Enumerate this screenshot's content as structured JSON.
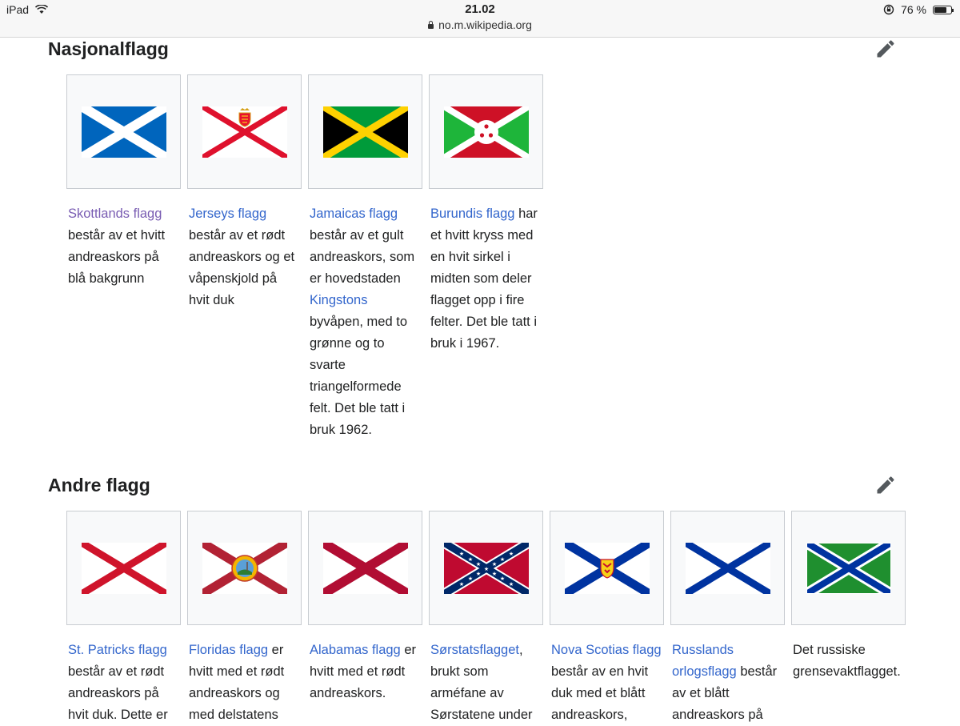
{
  "status": {
    "device": "iPad",
    "time": "21.02",
    "battery": "76 %",
    "url": "no.m.wikipedia.org"
  },
  "sections": [
    {
      "title": "Nasjonalflagg",
      "items": [
        {
          "link": "Skottlands flagg",
          "text": " består av et hvitt andreaskors på blå bakgrunn",
          "flag": "scotland-flag"
        },
        {
          "link": "Jerseys flagg",
          "text": " består av et rødt andreaskors og et våpenskjold på hvit duk",
          "flag": "jersey-flag"
        },
        {
          "link": "Jamaicas flagg",
          "text_a": " består av et gult andreaskors, som er hovedstaden ",
          "link2": "Kingstons",
          "text_b": " byvåpen, med to grønne og to svarte triangelformede felt. Det ble tatt i bruk 1962.",
          "flag": "jamaica-flag"
        },
        {
          "link": "Burundis flagg",
          "text": " har et hvitt kryss med en hvit sirkel i midten som deler flagget opp i fire felter. Det ble tatt i bruk i 1967.",
          "flag": "burundi-flag"
        }
      ]
    },
    {
      "title": "Andre flagg",
      "items": [
        {
          "link": "St. Patricks flagg",
          "text": " består av et rødt andreaskors på hvit duk. Dette er",
          "flag": "st-patricks-flag"
        },
        {
          "link": "Floridas flagg",
          "text": " er hvitt med et rødt andreaskors og med delstatens",
          "flag": "florida-flag"
        },
        {
          "link": "Alabamas flagg",
          "text": " er hvitt med et rødt andreaskors.",
          "flag": "alabama-flag"
        },
        {
          "link": "Sørstatsflagget",
          "text": ", brukt som arméfane av Sørstatene under",
          "flag": "confederate-flag"
        },
        {
          "link": "Nova Scotias flagg",
          "text": " består av en hvit duk med et blått andreaskors,",
          "flag": "nova-scotia-flag"
        },
        {
          "link": "Russlands orlogsflagg",
          "text": " består av et blått andreaskors på",
          "flag": "russian-naval-flag"
        },
        {
          "text": "Det russiske grensevaktflagget.",
          "flag": "russian-border-guard-flag"
        }
      ]
    }
  ],
  "colors": {
    "link": "#3366cc",
    "visited": "#795cb2",
    "text": "#202122"
  }
}
